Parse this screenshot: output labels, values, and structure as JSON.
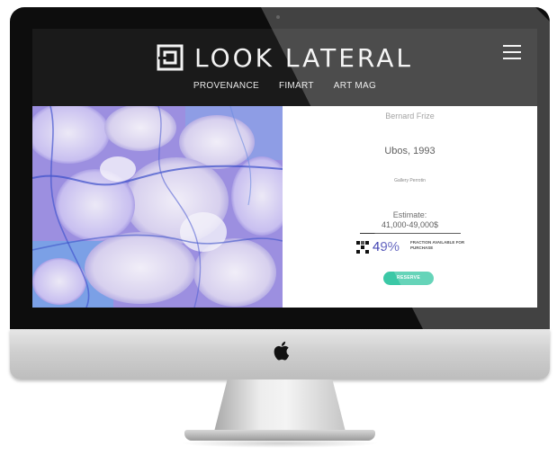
{
  "brand": {
    "name": "LOOK LATERAL"
  },
  "nav": {
    "items": [
      {
        "label": "PROVENANCE"
      },
      {
        "label": "FIMART"
      },
      {
        "label": "ART MAG"
      }
    ]
  },
  "artwork": {
    "artist": "Bernard Frize",
    "title": "Ubos, 1993",
    "gallery": "Gallery Perrotin",
    "estimate_label": "Estimate:",
    "estimate_value": "41,000-49,000$",
    "fraction_percent": "49%",
    "fraction_label": "FRACTION AVAILABLE FOR PURCHASE",
    "reserve_label": "RESERVE"
  },
  "icons": {
    "menu": "hamburger-menu-icon",
    "logo": "look-lateral-logo-mark",
    "fraction": "fraction-pixel-icon",
    "apple": "apple-logo-icon"
  },
  "colors": {
    "header_bg": "#1a1a1a",
    "accent_percent": "#3d3fb0",
    "reserve_button": "#3bc8a6",
    "artwork_base": "#b9b2e6"
  }
}
